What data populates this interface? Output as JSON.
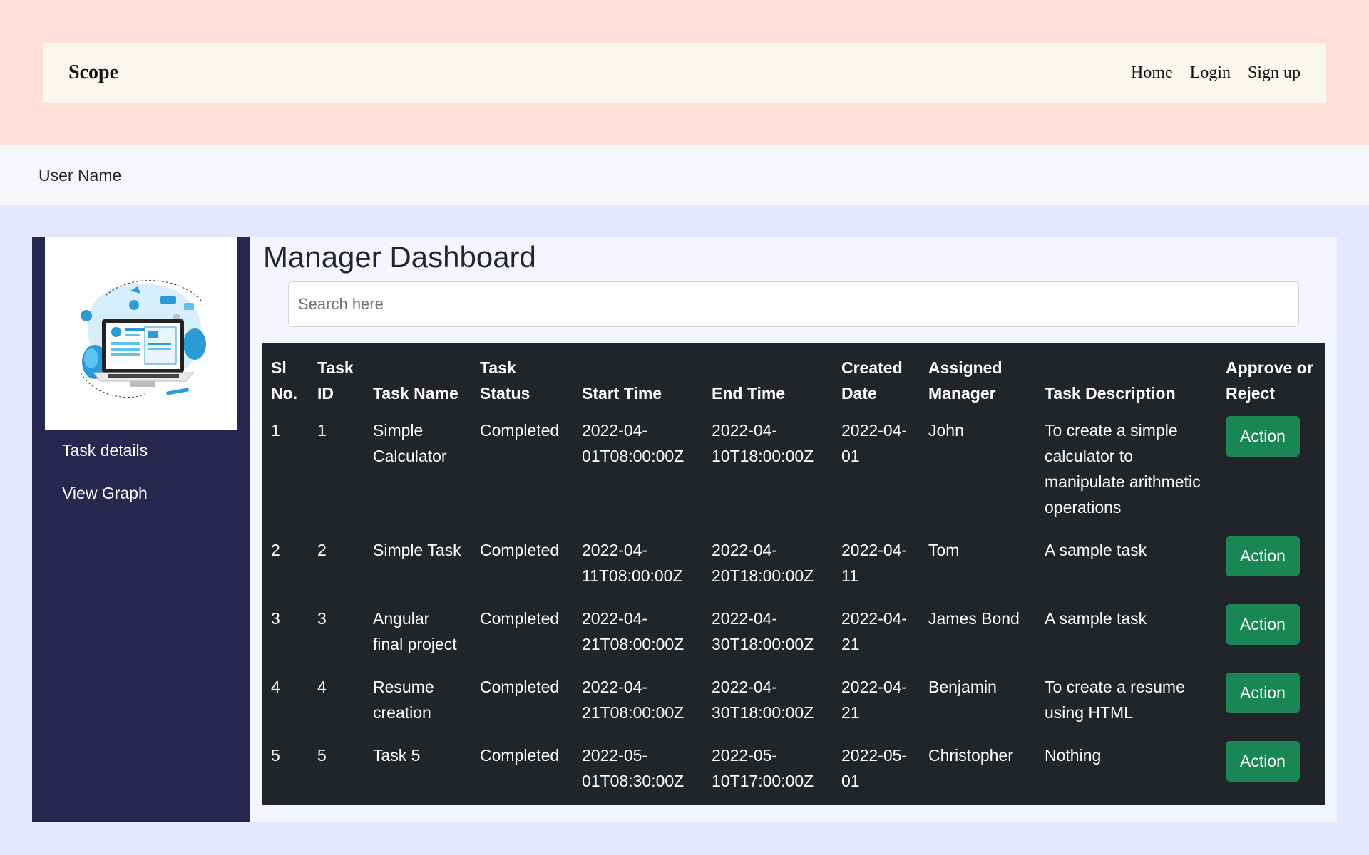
{
  "navbar": {
    "brand": "Scope",
    "links": [
      "Home",
      "Login",
      "Sign up"
    ]
  },
  "user": {
    "name": "User Name"
  },
  "sidebar": {
    "items": [
      {
        "label": "Task details"
      },
      {
        "label": "View Graph"
      }
    ]
  },
  "main": {
    "title": "Manager Dashboard",
    "search": {
      "placeholder": "Search here",
      "value": ""
    },
    "table": {
      "headers": [
        "Sl No.",
        "Task ID",
        "Task Name",
        "Task Status",
        "Start Time",
        "End Time",
        "Created Date",
        "Assigned Manager",
        "Task Description",
        "Approve or Reject"
      ],
      "rows": [
        [
          "1",
          "1",
          "Simple Calculator",
          "Completed",
          "2022-04-01T08:00:00Z",
          "2022-04-10T18:00:00Z",
          "2022-04-01",
          "John",
          "To create a simple calculator to manipulate arithmetic operations",
          "Action"
        ],
        [
          "2",
          "2",
          "Simple Task",
          "Completed",
          "2022-04-11T08:00:00Z",
          "2022-04-20T18:00:00Z",
          "2022-04-11",
          "Tom",
          "A sample task",
          "Action"
        ],
        [
          "3",
          "3",
          "Angular final project",
          "Completed",
          "2022-04-21T08:00:00Z",
          "2022-04-30T18:00:00Z",
          "2022-04-21",
          "James Bond",
          "A sample task",
          "Action"
        ],
        [
          "4",
          "4",
          "Resume creation",
          "Completed",
          "2022-04-21T08:00:00Z",
          "2022-04-30T18:00:00Z",
          "2022-04-21",
          "Benjamin",
          "To create a resume using HTML",
          "Action"
        ],
        [
          "5",
          "5",
          "Task 5",
          "Completed",
          "2022-05-01T08:30:00Z",
          "2022-05-10T17:00:00Z",
          "2022-05-01",
          "Christopher",
          "Nothing",
          "Action"
        ]
      ]
    }
  },
  "colors": {
    "top_band": "#ffdfd8",
    "navbar": "#faf7ee",
    "sidebar": "#26264e",
    "table": "#212529",
    "action_button": "#198754"
  }
}
